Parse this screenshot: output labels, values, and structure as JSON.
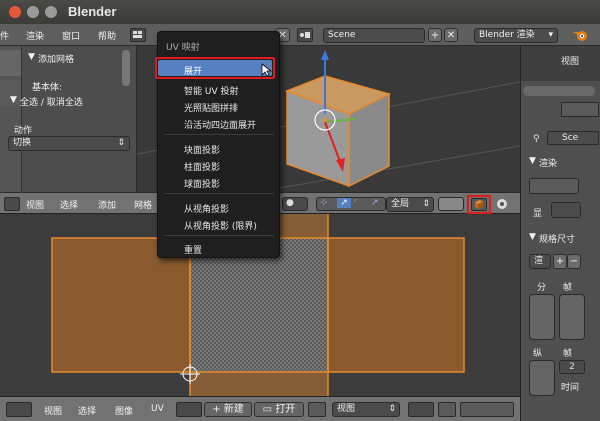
{
  "window": {
    "title": "Blender"
  },
  "infobar": {
    "menus": [
      "件",
      "渲染",
      "窗口",
      "帮助"
    ],
    "scene": "Scene",
    "engine": "Blender 渲染"
  },
  "tool_shelf": {
    "add_mesh": "添加网格",
    "basic": "基本体:",
    "select_toggle": "全选 / 取消全选",
    "action_label": "动作",
    "action_value": "切换"
  },
  "uv_menu": {
    "title": "UV 映射",
    "items": [
      "展开",
      "智能 UV 投射",
      "光照贴图拼排",
      "沿活动四边面展开",
      "块面投影",
      "柱面投影",
      "球面投影",
      "从视角投影",
      "从视角投影 (限界)",
      "重置"
    ]
  },
  "header3d": {
    "menus": [
      "视图",
      "选择",
      "添加",
      "网格"
    ],
    "orientation": "全局"
  },
  "uv_footer": {
    "menus": [
      "视图",
      "选择",
      "图像",
      "UV"
    ],
    "new_label": "新建",
    "open_label": "打开",
    "view_label": "视图"
  },
  "right_panel": {
    "view_label": "视图",
    "scene_label": "Sce",
    "render_label": "渲染",
    "display_label": "显",
    "dimensions_label": "规格尺寸",
    "render_preset": "渲",
    "frames_label": "帧",
    "split_label": "分",
    "vertical_label": "纵",
    "frame_value": "2",
    "time_label": "时间"
  },
  "colors": {
    "face_brown": "#8a5a2e",
    "selection_orange": "#e88a2a",
    "highlight_red": "#e01b1b",
    "menu_active": "#5680c2"
  }
}
